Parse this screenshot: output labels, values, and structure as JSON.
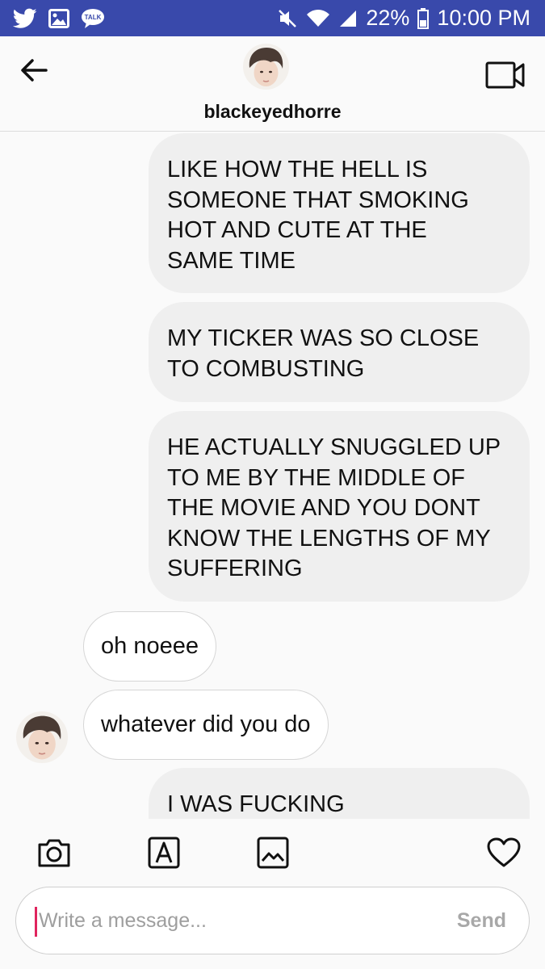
{
  "status_bar": {
    "left_icons": [
      "twitter-icon",
      "image-icon",
      "kakaotalk-icon"
    ],
    "talk_label": "TALK",
    "battery": "22%",
    "time": "10:00 PM",
    "right_icons": [
      "mute-icon",
      "wifi-icon",
      "signal-icon",
      "battery-icon"
    ],
    "background": "#3949ab"
  },
  "header": {
    "username": "blackeyedhorre",
    "back_icon": "arrow-left-icon",
    "video_icon": "video-call-icon"
  },
  "messages": [
    {
      "direction": "outgoing",
      "lines": [
        "LIKE HOW THE HELL IS",
        "SOMEONE THAT SMOKING",
        "HOT AND CUTE AT THE",
        "SAME TIME"
      ]
    },
    {
      "direction": "outgoing",
      "lines": [
        "MY TICKER WAS SO CLOSE",
        "TO COMBUSTING"
      ]
    },
    {
      "direction": "outgoing",
      "lines": [
        "HE ACTUALLY SNUGGLED UP",
        "TO ME BY THE MIDDLE OF",
        "THE MOVIE AND YOU DONT",
        "KNOW THE LENGTHS OF MY",
        "SUFFERING"
      ]
    },
    {
      "direction": "incoming",
      "lines": [
        "oh noeee"
      ]
    },
    {
      "direction": "incoming",
      "lines": [
        "whatever did you do"
      ]
    },
    {
      "direction": "outgoing",
      "lines": [
        "I WAS FUCKING"
      ]
    }
  ],
  "toolbar": {
    "icons": [
      "camera-icon",
      "text-style-icon",
      "gallery-icon",
      "heart-icon"
    ]
  },
  "composer": {
    "placeholder": "Write a message...",
    "value": "",
    "send_label": "Send"
  },
  "colors": {
    "status_bar": "#3949ab",
    "outgoing_bubble": "#efefef",
    "incoming_bubble": "#ffffff",
    "cursor": "#e0245e"
  }
}
